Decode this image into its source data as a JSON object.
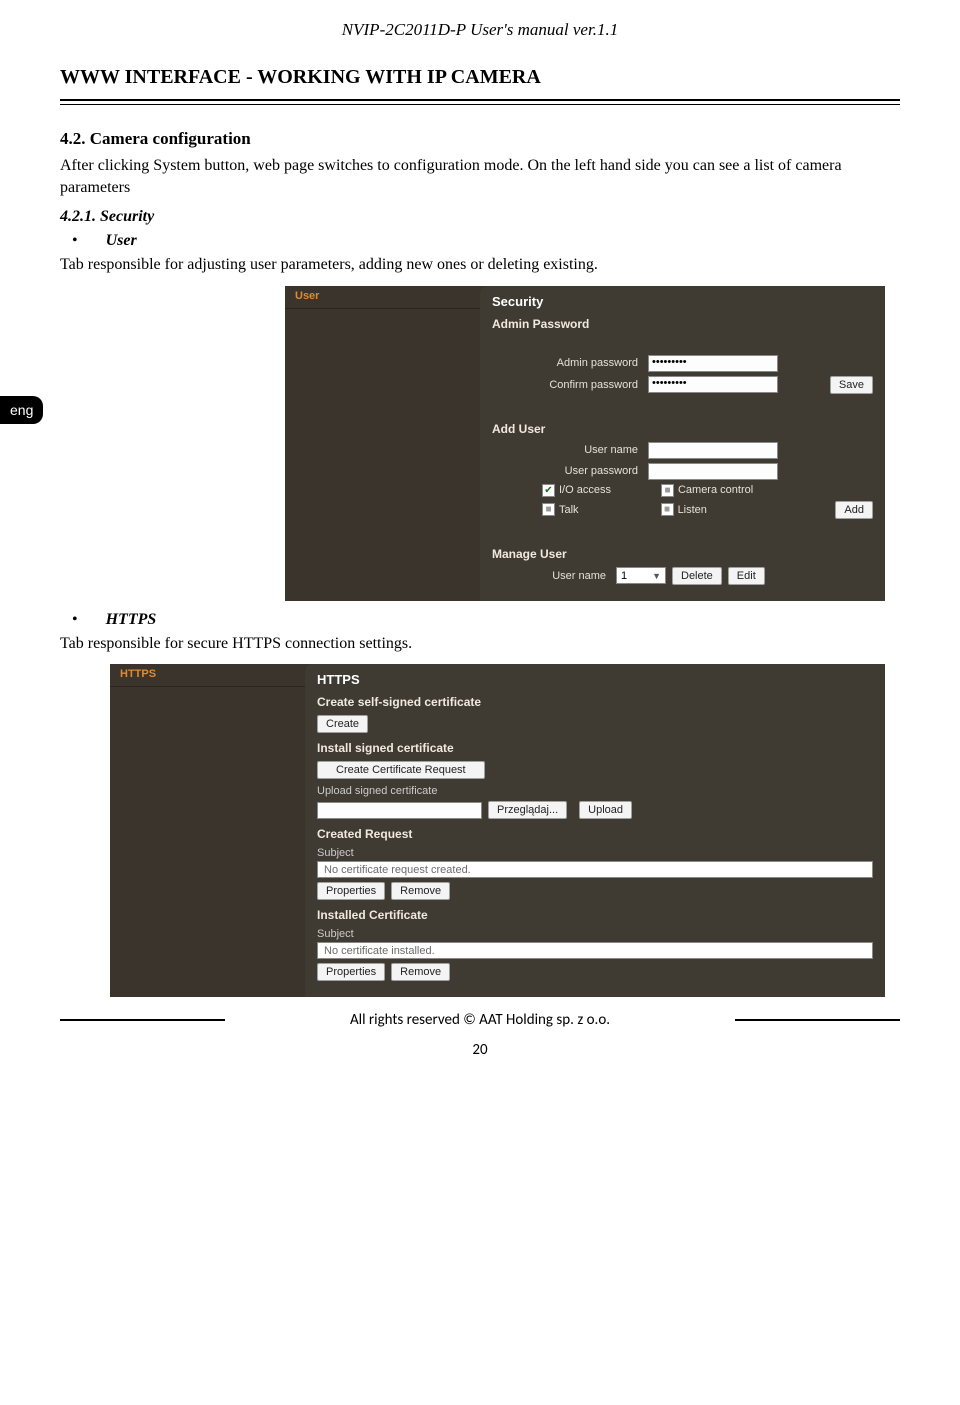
{
  "header_line": "NVIP-2C2011D-P User's manual ver.1.1",
  "section_head": "WWW INTERFACE - WORKING WITH IP CAMERA",
  "lang_tab": "eng",
  "s42": {
    "num_title": "4.2. Camera configuration",
    "para1": "After clicking System button, web page switches to configuration mode. On the left hand side you can see a list of camera parameters",
    "sec_title": "4.2.1. Security",
    "bullet_user": "User",
    "para2": "Tab responsible for adjusting user parameters, adding new ones or deleting existing.",
    "bullet_https": "HTTPS",
    "para3": "Tab responsible for secure HTTPS connection settings."
  },
  "shot1": {
    "sidebar_user": "User",
    "panel_title": "Security",
    "group_admin": "Admin Password",
    "lbl_admin_pw": "Admin password",
    "val_admin_pw": "•••••••••",
    "lbl_confirm_pw": "Confirm password",
    "val_confirm_pw": "•••••••••",
    "btn_save": "Save",
    "group_add": "Add User",
    "lbl_user_name": "User name",
    "lbl_user_pw": "User password",
    "chk_io": "I/O access",
    "chk_cam": "Camera control",
    "chk_talk": "Talk",
    "chk_listen": "Listen",
    "btn_add": "Add",
    "group_manage": "Manage User",
    "lbl_manage_user": "User name",
    "sel_value": "1",
    "btn_delete": "Delete",
    "btn_edit": "Edit"
  },
  "shot2": {
    "sidebar_https": "HTTPS",
    "panel_title": "HTTPS",
    "grp_create_self": "Create self-signed certificate",
    "btn_create": "Create",
    "grp_install_signed": "Install signed certificate",
    "btn_create_req": "Create Certificate Request",
    "lbl_upload_signed": "Upload signed certificate",
    "btn_browse": "Przeglądaj...",
    "btn_upload": "Upload",
    "grp_created_req": "Created Request",
    "lbl_subject1": "Subject",
    "readonly_req": "No certificate request created.",
    "btn_properties": "Properties",
    "btn_remove": "Remove",
    "grp_installed_cert": "Installed Certificate",
    "lbl_subject2": "Subject",
    "readonly_cert": "No certificate installed."
  },
  "footer": "All rights reserved © AAT Holding sp. z o.o.",
  "page_number": "20"
}
